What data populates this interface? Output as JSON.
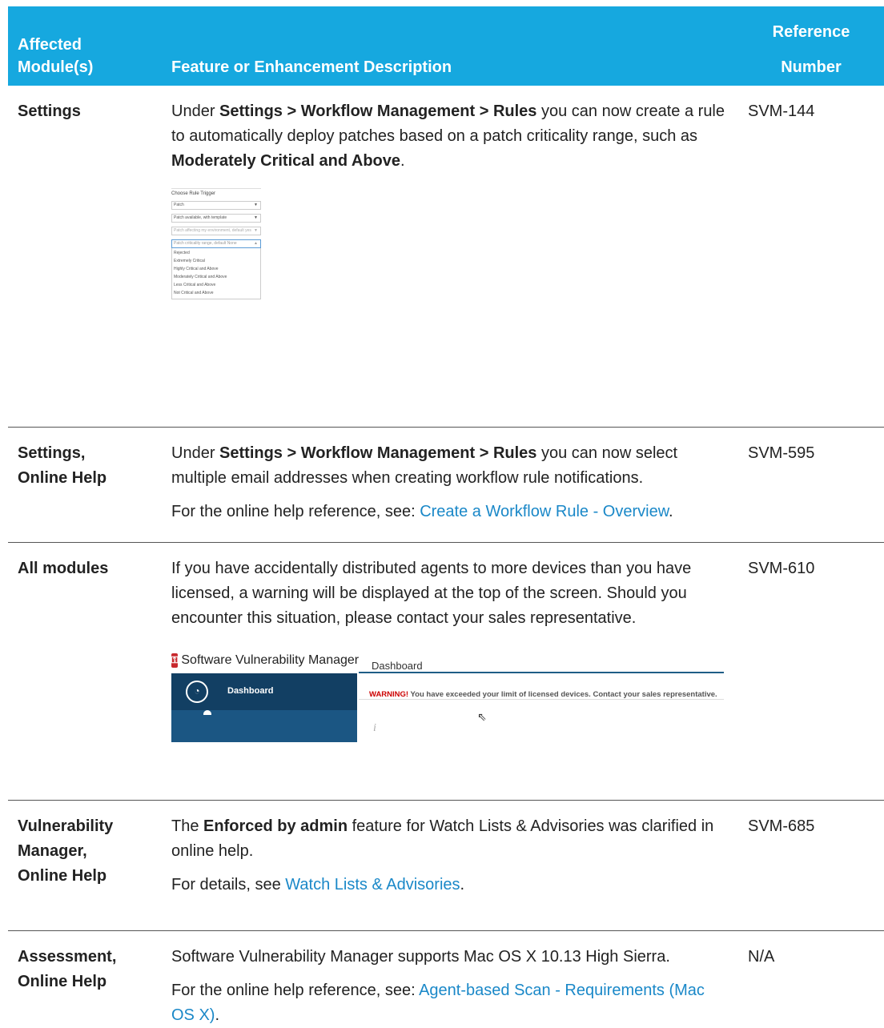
{
  "header": {
    "col1": "Affected Module(s)",
    "col1_line1": "Affected",
    "col1_line2": "Module(s)",
    "col2": "Feature or Enhancement Description",
    "col3_line1": "Reference",
    "col3_line2": "Number"
  },
  "rows": [
    {
      "module": "Settings",
      "desc_a": "Under ",
      "desc_b": "Settings > Workflow Management > Rules",
      "desc_c": " you can now create a rule to automatically deploy patches based on a patch criticality range, such as ",
      "desc_d": "Moderately Critical and Above",
      "desc_e": ".",
      "ref": "SVM-144",
      "screenshot": {
        "title": "Choose Rule Trigger",
        "selects": [
          "Patch",
          "Patch available, with template",
          "Patch affecting my environment, default yes",
          "Patch criticality range, default None"
        ],
        "options": [
          "Rejected",
          "Extremely Critical",
          "Highly Critical and Above",
          "Moderately Critical and Above",
          "Less Critical and Above",
          "Not Critical and Above"
        ]
      }
    },
    {
      "module_line1": "Settings,",
      "module_line2": "Online Help",
      "desc_a": "Under ",
      "desc_b": "Settings > Workflow Management > Rules",
      "desc_c": " you can now select multiple email addresses when creating workflow rule notifications.",
      "note": "For the online help reference, see: ",
      "link": "Create a Workflow Rule - Overview",
      "note_end": ".",
      "ref": "SVM-595"
    },
    {
      "module": "All modules",
      "desc": "If you have accidentally distributed agents to more devices than you have licensed, a warning will be displayed at the top of the screen. Should you encounter this situation, please contact your sales representative.",
      "ref": "SVM-610",
      "screenshot": {
        "app_name": "Software Vulnerability Manager",
        "crumb": "Dashboard",
        "nav_label": "Dashboard",
        "warning_label": "WARNING!",
        "warning_text": " You have exceeded your limit of licensed devices. Contact your sales representative."
      }
    },
    {
      "module_line1": "Vulnerability",
      "module_line2": "Manager,",
      "module_line3": "Online Help",
      "desc_a": "The ",
      "desc_b": "Enforced by admin",
      "desc_c": " feature for Watch Lists & Advisories was clarified in online help.",
      "note": "For details, see ",
      "link": "Watch Lists & Advisories",
      "note_end": ".",
      "ref": "SVM-685"
    },
    {
      "module_line1": "Assessment,",
      "module_line2": "Online Help",
      "desc": "Software Vulnerability Manager supports Mac OS X 10.13 High Sierra.",
      "note": "For the online help reference, see: ",
      "link": "Agent-based Scan - Requirements (Mac OS X)",
      "note_end": ".",
      "ref": "N/A"
    }
  ]
}
